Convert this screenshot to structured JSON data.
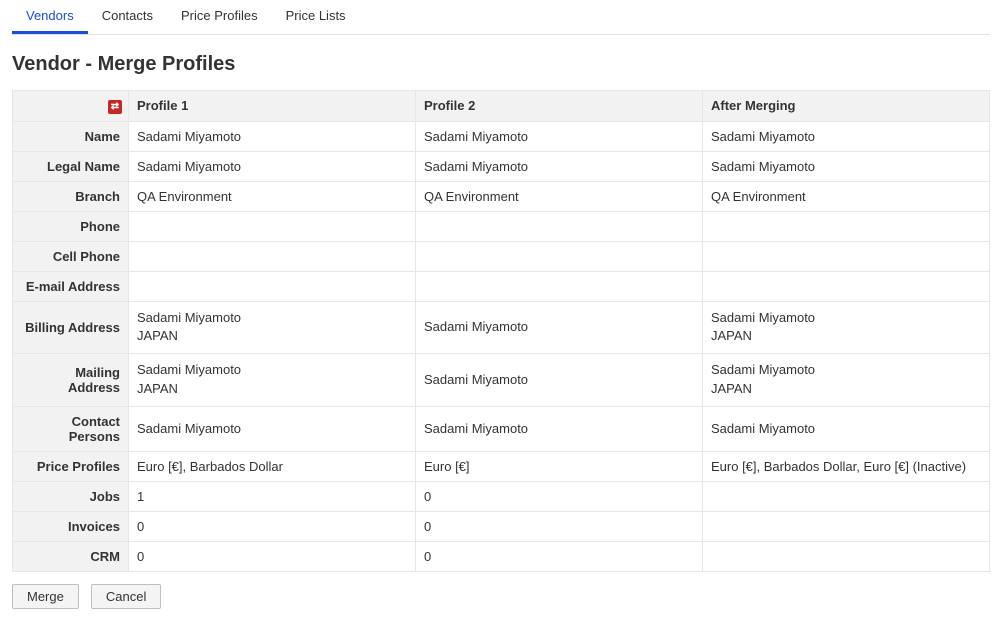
{
  "tabs": [
    {
      "label": "Vendors",
      "active": true
    },
    {
      "label": "Contacts",
      "active": false
    },
    {
      "label": "Price Profiles",
      "active": false
    },
    {
      "label": "Price Lists",
      "active": false
    }
  ],
  "page_title": "Vendor - Merge Profiles",
  "columns": {
    "profile1": "Profile 1",
    "profile2": "Profile 2",
    "after": "After Merging"
  },
  "rows": [
    {
      "label": "Name",
      "p1": "Sadami Miyamoto",
      "p2": "Sadami Miyamoto",
      "after": "Sadami Miyamoto"
    },
    {
      "label": "Legal Name",
      "p1": "Sadami Miyamoto",
      "p2": "Sadami Miyamoto",
      "after": "Sadami Miyamoto"
    },
    {
      "label": "Branch",
      "p1": "QA Environment",
      "p2": "QA Environment",
      "after": "QA Environment"
    },
    {
      "label": "Phone",
      "p1": "",
      "p2": "",
      "after": ""
    },
    {
      "label": "Cell Phone",
      "p1": "",
      "p2": "",
      "after": ""
    },
    {
      "label": "E-mail Address",
      "p1": "",
      "p2": "",
      "after": ""
    },
    {
      "label": "Billing Address",
      "p1": "Sadami Miyamoto\nJAPAN",
      "p2": "Sadami Miyamoto",
      "after": "Sadami Miyamoto\nJAPAN"
    },
    {
      "label": "Mailing Address",
      "p1": "Sadami Miyamoto\nJAPAN",
      "p2": "Sadami Miyamoto",
      "after": "Sadami Miyamoto\nJAPAN"
    },
    {
      "label": "Contact Persons",
      "p1": "Sadami Miyamoto",
      "p2": "Sadami Miyamoto",
      "after": "Sadami Miyamoto"
    },
    {
      "label": "Price Profiles",
      "p1": "Euro [€], Barbados Dollar",
      "p2": "Euro [€]",
      "after": "Euro [€], Barbados Dollar, Euro [€] (Inactive)"
    },
    {
      "label": "Jobs",
      "p1": "1",
      "p2": "0",
      "after": ""
    },
    {
      "label": "Invoices",
      "p1": "0",
      "p2": "0",
      "after": ""
    },
    {
      "label": "CRM",
      "p1": "0",
      "p2": "0",
      "after": ""
    }
  ],
  "buttons": {
    "merge": "Merge",
    "cancel": "Cancel"
  }
}
